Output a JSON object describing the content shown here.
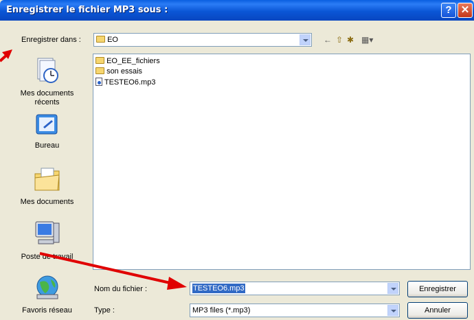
{
  "window": {
    "title": "Enregistrer le fichier MP3 sous :",
    "help_glyph": "?",
    "close_glyph": "✕"
  },
  "save_in": {
    "label": "Enregistrer dans :",
    "value": "EO"
  },
  "toolbar": {
    "back_glyph": "←",
    "up_glyph": "⇧",
    "new_folder_glyph": "✱",
    "view_glyph": "▦▾"
  },
  "places": [
    {
      "label": "Mes documents récents",
      "icon": "recent-documents-icon"
    },
    {
      "label": "Bureau",
      "icon": "desktop-icon"
    },
    {
      "label": "Mes documents",
      "icon": "my-documents-icon"
    },
    {
      "label": "Poste de travail",
      "icon": "my-computer-icon"
    },
    {
      "label": "Favoris réseau",
      "icon": "network-places-icon"
    }
  ],
  "files": [
    {
      "name": "EO_EE_fichiers",
      "type": "folder"
    },
    {
      "name": "son essais",
      "type": "folder"
    },
    {
      "name": "TESTEO6.mp3",
      "type": "mp3"
    }
  ],
  "filename": {
    "label": "Nom du fichier :",
    "value": "TESTEO6.mp3"
  },
  "filetype": {
    "label": "Type :",
    "value": "MP3 files (*.mp3)"
  },
  "buttons": {
    "save": "Enregistrer",
    "cancel": "Annuler"
  },
  "colors": {
    "titlebar": "#0a56d6",
    "dialog_bg": "#ece9d8",
    "selection": "#316ac5",
    "annotation_arrow": "#e00000"
  }
}
